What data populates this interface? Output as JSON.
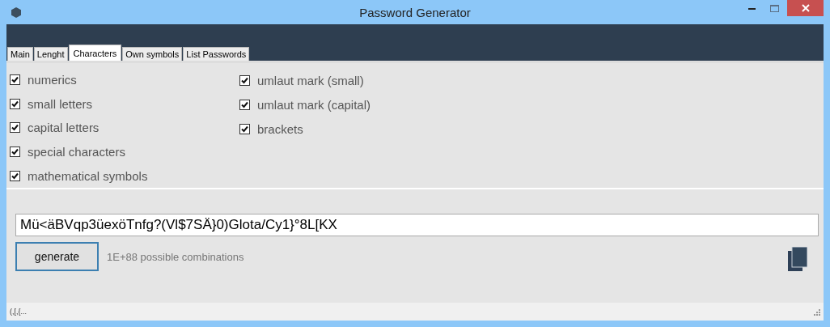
{
  "window": {
    "title": "Password Generator"
  },
  "tabs": [
    {
      "label": "Main",
      "selected": false
    },
    {
      "label": "Lenght",
      "selected": false
    },
    {
      "label": "Characters",
      "selected": true
    },
    {
      "label": "Own symbols",
      "selected": false
    },
    {
      "label": "List Passwords",
      "selected": false
    }
  ],
  "option_columns": [
    [
      {
        "label": "numerics",
        "checked": true
      },
      {
        "label": "small letters",
        "checked": true
      },
      {
        "label": "capital letters",
        "checked": true
      },
      {
        "label": "special characters",
        "checked": true
      },
      {
        "label": "mathematical symbols",
        "checked": true
      }
    ],
    [
      {
        "label": "umlaut mark (small)",
        "checked": true
      },
      {
        "label": "umlaut mark (capital)",
        "checked": true
      },
      {
        "label": "brackets",
        "checked": true
      }
    ]
  ],
  "password": {
    "value": "Mü<äBVqp3üexöTnfg?(Vl$7SÄ}0)Glota/Cy1}°8L[KX"
  },
  "generate_button": "generate",
  "combinations": "1E+88 possible combinations",
  "status_bar": "(,[,{..."
}
